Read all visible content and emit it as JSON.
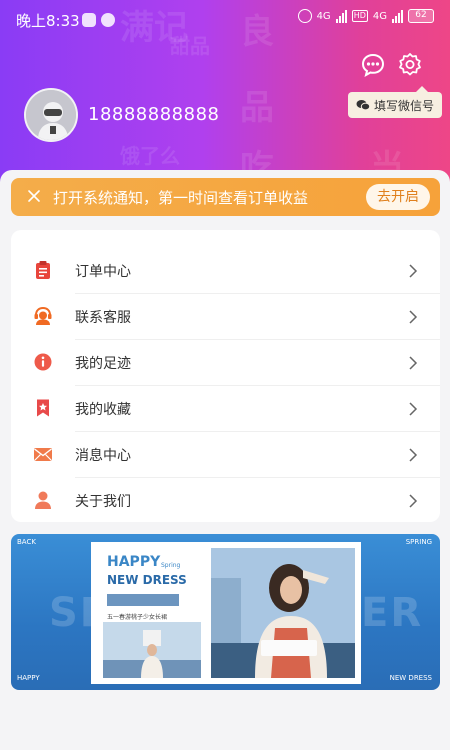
{
  "status_bar": {
    "time": "晚上8:33",
    "network_1": "4G",
    "network_2": "4G",
    "hd_label": "HD",
    "battery": "62"
  },
  "header": {
    "phone": "18888888888",
    "wechat_tip": "填写微信号",
    "watermarks": [
      "满记",
      "甜品",
      "良",
      "品",
      "饿了么",
      "吃",
      "当"
    ]
  },
  "notice": {
    "text": "打开系统通知，第一时间查看订单收益",
    "button": "去开启"
  },
  "menu": {
    "items": [
      {
        "label": "订单中心",
        "icon": "clipboard-icon",
        "color": "#e8453c"
      },
      {
        "label": "联系客服",
        "icon": "support-agent-icon",
        "color": "#f06a23"
      },
      {
        "label": "我的足迹",
        "icon": "info-icon",
        "color": "#ee5a4a"
      },
      {
        "label": "我的收藏",
        "icon": "bookmark-icon",
        "color": "#e84a4a"
      },
      {
        "label": "消息中心",
        "icon": "envelope-icon",
        "color": "#f07a4a"
      },
      {
        "label": "关于我们",
        "icon": "person-icon",
        "color": "#f07a5a"
      }
    ]
  },
  "banner": {
    "tl": "BACK",
    "tr": "SPRING",
    "bl": "HAPPY",
    "br": "NEW DRESS",
    "happy": "HAPPY",
    "spring": "Spring",
    "new_dress": "NEW DRESS",
    "slogan": "五一春游桃子少女长裙",
    "big_left": "SP",
    "big_right": "ER"
  },
  "colors": {
    "gradient_start": "#8a3cf5",
    "gradient_end": "#ee4687",
    "notice_orange": "#f4ad4a",
    "banner_blue": "#2c76c2"
  }
}
